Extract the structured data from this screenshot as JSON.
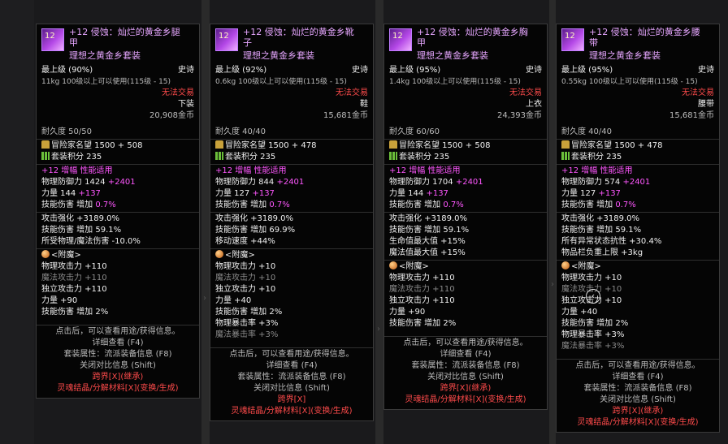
{
  "tooltips": [
    {
      "name_line1": "+12 侵蚀：灿烂的黄金乡腿",
      "name_line2": "甲",
      "set_name": "理想之黄金乡套装",
      "grade": "最上级 (90%)",
      "rarity": "史诗",
      "weight_req": "11kg 100级以上可以使用(115级 - 15)",
      "trade": "无法交易",
      "slot": "下装",
      "price": "20,908金币",
      "durability": "耐久度 50/50",
      "fame": "冒险家名望 1500 + 508",
      "set_points": "套装积分 235",
      "amp": "+12 增幅 性能适用",
      "defense_base": "物理防御力 1424",
      "defense_bonus": "+2401",
      "stat_base": "力量 144",
      "stat_bonus": "+137",
      "skill_dmg": "技能伤害 增加",
      "skill_dmg_val": "0.7%",
      "opts": [
        "攻击强化 +3189.0%",
        "技能伤害 增加 59.1%",
        "所受物理/魔法伤害 -10.0%"
      ],
      "enchant_label": "<附魔>",
      "enchants": [
        {
          "text": "物理攻击力 +110",
          "dim": false
        },
        {
          "text": "魔法攻击力 +110",
          "dim": true
        },
        {
          "text": "独立攻击力 +110",
          "dim": false
        },
        {
          "text": "力量 +90",
          "dim": false
        },
        {
          "text": "技能伤害 增加 2%",
          "dim": false
        }
      ],
      "foot": [
        "点击后，可以查看用途/获得信息。",
        "详细查看 (F4)",
        "套装属性：流派装备信息 (F8)",
        "关闭对比信息 (Shift)"
      ],
      "cross": "跨界[X](继承)",
      "soul": "灵魂结晶/分解材料[X](变换/生成)"
    },
    {
      "name_line1": "+12 侵蚀：灿烂的黄金乡靴",
      "name_line2": "子",
      "set_name": "理想之黄金乡套装",
      "grade": "最上级 (92%)",
      "rarity": "史诗",
      "weight_req": "0.6kg 100级以上可以使用(115级 - 15)",
      "trade": "无法交易",
      "slot": "鞋",
      "price": "15,681金币",
      "durability": "耐久度 40/40",
      "fame": "冒险家名望 1500 + 478",
      "set_points": "套装积分 235",
      "amp": "+12 增幅 性能适用",
      "defense_base": "物理防御力 844",
      "defense_bonus": "+2401",
      "stat_base": "力量 127",
      "stat_bonus": "+137",
      "skill_dmg": "技能伤害 增加",
      "skill_dmg_val": "0.7%",
      "opts": [
        "攻击强化 +3189.0%",
        "技能伤害 增加 69.9%",
        "移动速度 +44%"
      ],
      "enchant_label": "<附魔>",
      "enchants": [
        {
          "text": "物理攻击力 +10",
          "dim": false
        },
        {
          "text": "魔法攻击力 +10",
          "dim": true
        },
        {
          "text": "独立攻击力 +10",
          "dim": false
        },
        {
          "text": "力量 +40",
          "dim": false
        },
        {
          "text": "技能伤害 增加 2%",
          "dim": false
        },
        {
          "text": "物理暴击率 +3%",
          "dim": false
        },
        {
          "text": "魔法暴击率 +3%",
          "dim": true
        }
      ],
      "foot": [
        "点击后，可以查看用途/获得信息。",
        "详细查看 (F4)",
        "套装属性：流派装备信息 (F8)",
        "关闭对比信息 (Shift)"
      ],
      "cross": "跨界[X]",
      "soul": "灵魂结晶/分解材料[X](变换/生成)"
    },
    {
      "name_line1": "+12 侵蚀：灿烂的黄金乡胸",
      "name_line2": "甲",
      "set_name": "理想之黄金乡套装",
      "grade": "最上级 (95%)",
      "rarity": "史诗",
      "weight_req": "1.4kg 100级以上可以使用(115级 - 15)",
      "trade": "无法交易",
      "slot": "上衣",
      "price": "24,393金币",
      "durability": "耐久度 60/60",
      "fame": "冒险家名望 1500 + 508",
      "set_points": "套装积分 235",
      "amp": "+12 增幅 性能适用",
      "defense_base": "物理防御力 1704",
      "defense_bonus": "+2401",
      "stat_base": "力量 144",
      "stat_bonus": "+137",
      "skill_dmg": "技能伤害 增加",
      "skill_dmg_val": "0.7%",
      "opts": [
        "攻击强化 +3189.0%",
        "技能伤害 增加 59.1%",
        "生命值最大值 +15%",
        "魔法值最大值 +15%"
      ],
      "enchant_label": "<附魔>",
      "enchants": [
        {
          "text": "物理攻击力 +110",
          "dim": false
        },
        {
          "text": "魔法攻击力 +110",
          "dim": true
        },
        {
          "text": "独立攻击力 +110",
          "dim": false
        },
        {
          "text": "力量 +90",
          "dim": false
        },
        {
          "text": "技能伤害 增加 2%",
          "dim": false
        }
      ],
      "foot": [
        "点击后，可以查看用途/获得信息。",
        "详细查看 (F4)",
        "套装属性：流派装备信息 (F8)",
        "关闭对比信息 (Shift)"
      ],
      "cross": "跨界[X](继承)",
      "soul": "灵魂结晶/分解材料[X](变换/生成)"
    },
    {
      "name_line1": "+12 侵蚀：灿烂的黄金乡腰",
      "name_line2": "带",
      "set_name": "理想之黄金乡套装",
      "grade": "最上级 (95%)",
      "rarity": "史诗",
      "weight_req": "0.55kg 100级以上可以使用(115级 - 15)",
      "trade": "无法交易",
      "slot": "腰带",
      "price": "15,681金币",
      "durability": "耐久度 40/40",
      "fame": "冒险家名望 1500 + 478",
      "set_points": "套装积分 235",
      "amp": "+12 增幅 性能适用",
      "defense_base": "物理防御力 574",
      "defense_bonus": "+2401",
      "stat_base": "力量 127",
      "stat_bonus": "+137",
      "skill_dmg": "技能伤害 增加",
      "skill_dmg_val": "0.7%",
      "opts": [
        "攻击强化 +3189.0%",
        "技能伤害 增加 59.1%",
        "所有异常状态抗性 +30.4%",
        "物品栏负重上限 +3kg"
      ],
      "enchant_label": "<附魔>",
      "enchants": [
        {
          "text": "物理攻击力 +10",
          "dim": false
        },
        {
          "text": "魔法攻击力 +10",
          "dim": true
        },
        {
          "text": "独立攻击力 +10",
          "dim": false
        },
        {
          "text": "力量 +40",
          "dim": false
        },
        {
          "text": "技能伤害 增加 2%",
          "dim": false
        },
        {
          "text": "物理暴击率 +3%",
          "dim": false
        },
        {
          "text": "魔法暴击率 +3%",
          "dim": true
        }
      ],
      "foot": [
        "点击后，可以查看用途/获得信息。",
        "详细查看 (F4)",
        "套装属性：流派装备信息 (F8)",
        "关闭对比信息 (Shift)"
      ],
      "cross": "跨界[X](继承)",
      "soul": "灵魂结晶/分解材料[X](变换/生成)"
    }
  ]
}
